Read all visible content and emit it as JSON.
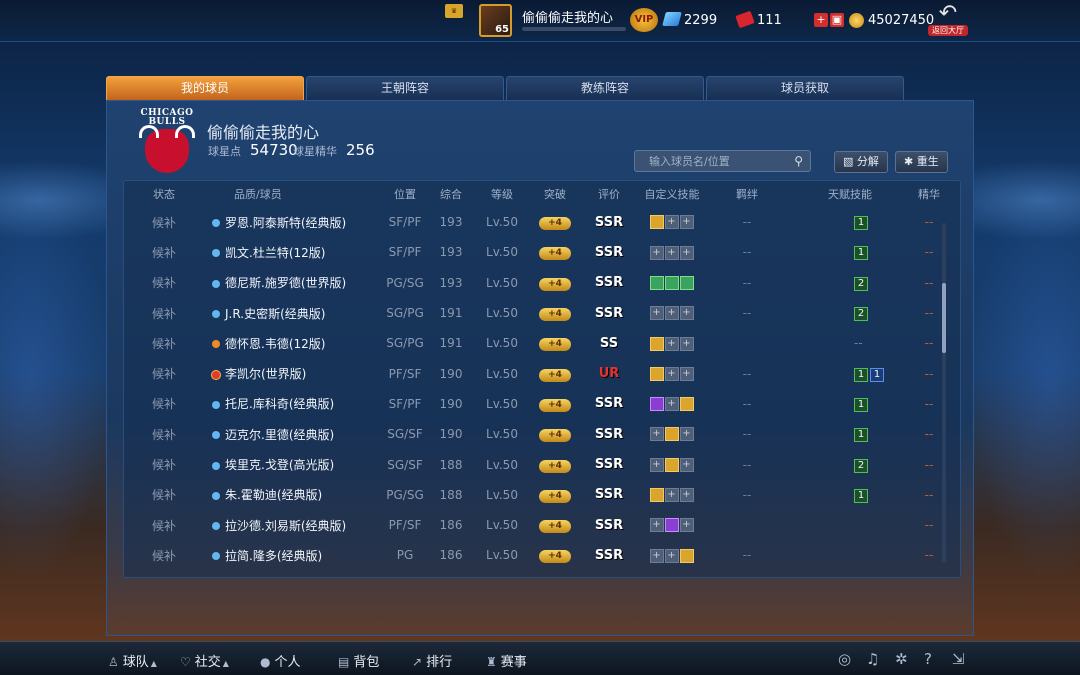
{
  "topbar": {
    "player_name": "偷偷偷走我的心",
    "player_level": "65",
    "vip_label": "VIP",
    "gems": "2299",
    "tickets": "111",
    "coins": "45027450",
    "back_label": "返回大厅"
  },
  "tabs": [
    "我的球员",
    "王朝阵容",
    "教练阵容",
    "球员获取"
  ],
  "team": {
    "logo_text": "CHICAGO BULLS",
    "name": "偷偷偷走我的心",
    "star_points_label": "球星点",
    "star_points": "54730",
    "essence_label": "球星精华",
    "essence": "256"
  },
  "search": {
    "placeholder": "输入球员名/位置"
  },
  "actions": {
    "decompose": "分解",
    "reborn": "重生"
  },
  "table": {
    "headers": [
      "状态",
      "品质/球员",
      "位置",
      "综合",
      "等级",
      "突破",
      "评价",
      "自定义技能",
      "羁绊",
      "天赋技能",
      "精华"
    ],
    "rows": [
      {
        "status": "候补",
        "name": "罗恩.阿泰斯特(经典版)",
        "pos": "SF/PF",
        "ovr": "193",
        "lvl": "Lv.50",
        "brk": "+4",
        "rating": "SSR",
        "bond": "--",
        "talent": [
          "1"
        ],
        "ess": "--"
      },
      {
        "status": "候补",
        "name": "凯文.杜兰特(12版)",
        "pos": "SF/PF",
        "ovr": "193",
        "lvl": "Lv.50",
        "brk": "+4",
        "rating": "SSR",
        "bond": "--",
        "talent": [
          "1"
        ],
        "ess": "--"
      },
      {
        "status": "候补",
        "name": "德尼斯.施罗德(世界版)",
        "pos": "PG/SG",
        "ovr": "193",
        "lvl": "Lv.50",
        "brk": "+4",
        "rating": "SSR",
        "bond": "--",
        "talent": [
          "2"
        ],
        "ess": "--"
      },
      {
        "status": "候补",
        "name": "J.R.史密斯(经典版)",
        "pos": "SG/PG",
        "ovr": "191",
        "lvl": "Lv.50",
        "brk": "+4",
        "rating": "SSR",
        "bond": "--",
        "talent": [
          "2"
        ],
        "ess": "--"
      },
      {
        "status": "候补",
        "name": "德怀恩.韦德(12版)",
        "pos": "SG/PG",
        "ovr": "191",
        "lvl": "Lv.50",
        "brk": "+4",
        "rating": "SS",
        "bond": "",
        "talent": [],
        "ess": "--"
      },
      {
        "status": "候补",
        "name": "李凯尔(世界版)",
        "pos": "PF/SF",
        "ovr": "190",
        "lvl": "Lv.50",
        "brk": "+4",
        "rating": "UR",
        "bond": "--",
        "talent": [
          "1",
          "1"
        ],
        "ess": "--"
      },
      {
        "status": "候补",
        "name": "托尼.库科奇(经典版)",
        "pos": "SF/PF",
        "ovr": "190",
        "lvl": "Lv.50",
        "brk": "+4",
        "rating": "SSR",
        "bond": "--",
        "talent": [
          "1"
        ],
        "ess": "--"
      },
      {
        "status": "候补",
        "name": "迈克尔.里德(经典版)",
        "pos": "SG/SF",
        "ovr": "190",
        "lvl": "Lv.50",
        "brk": "+4",
        "rating": "SSR",
        "bond": "--",
        "talent": [
          "1"
        ],
        "ess": "--"
      },
      {
        "status": "候补",
        "name": "埃里克.戈登(高光版)",
        "pos": "SG/SF",
        "ovr": "188",
        "lvl": "Lv.50",
        "brk": "+4",
        "rating": "SSR",
        "bond": "--",
        "talent": [
          "2"
        ],
        "ess": "--"
      },
      {
        "status": "候补",
        "name": "朱.霍勒迪(经典版)",
        "pos": "PG/SG",
        "ovr": "188",
        "lvl": "Lv.50",
        "brk": "+4",
        "rating": "SSR",
        "bond": "--",
        "talent": [
          "1"
        ],
        "ess": "--"
      },
      {
        "status": "候补",
        "name": "拉沙德.刘易斯(经典版)",
        "pos": "PF/SF",
        "ovr": "186",
        "lvl": "Lv.50",
        "brk": "+4",
        "rating": "SSR",
        "bond": "",
        "talent": [],
        "ess": "--"
      },
      {
        "status": "候补",
        "name": "拉简.隆多(经典版)",
        "pos": "PG",
        "ovr": "186",
        "lvl": "Lv.50",
        "brk": "+4",
        "rating": "SSR",
        "bond": "--",
        "talent": [],
        "ess": "--"
      }
    ]
  },
  "bottom_nav": [
    "球队",
    "社交",
    "个人",
    "背包",
    "排行",
    "赛事"
  ]
}
